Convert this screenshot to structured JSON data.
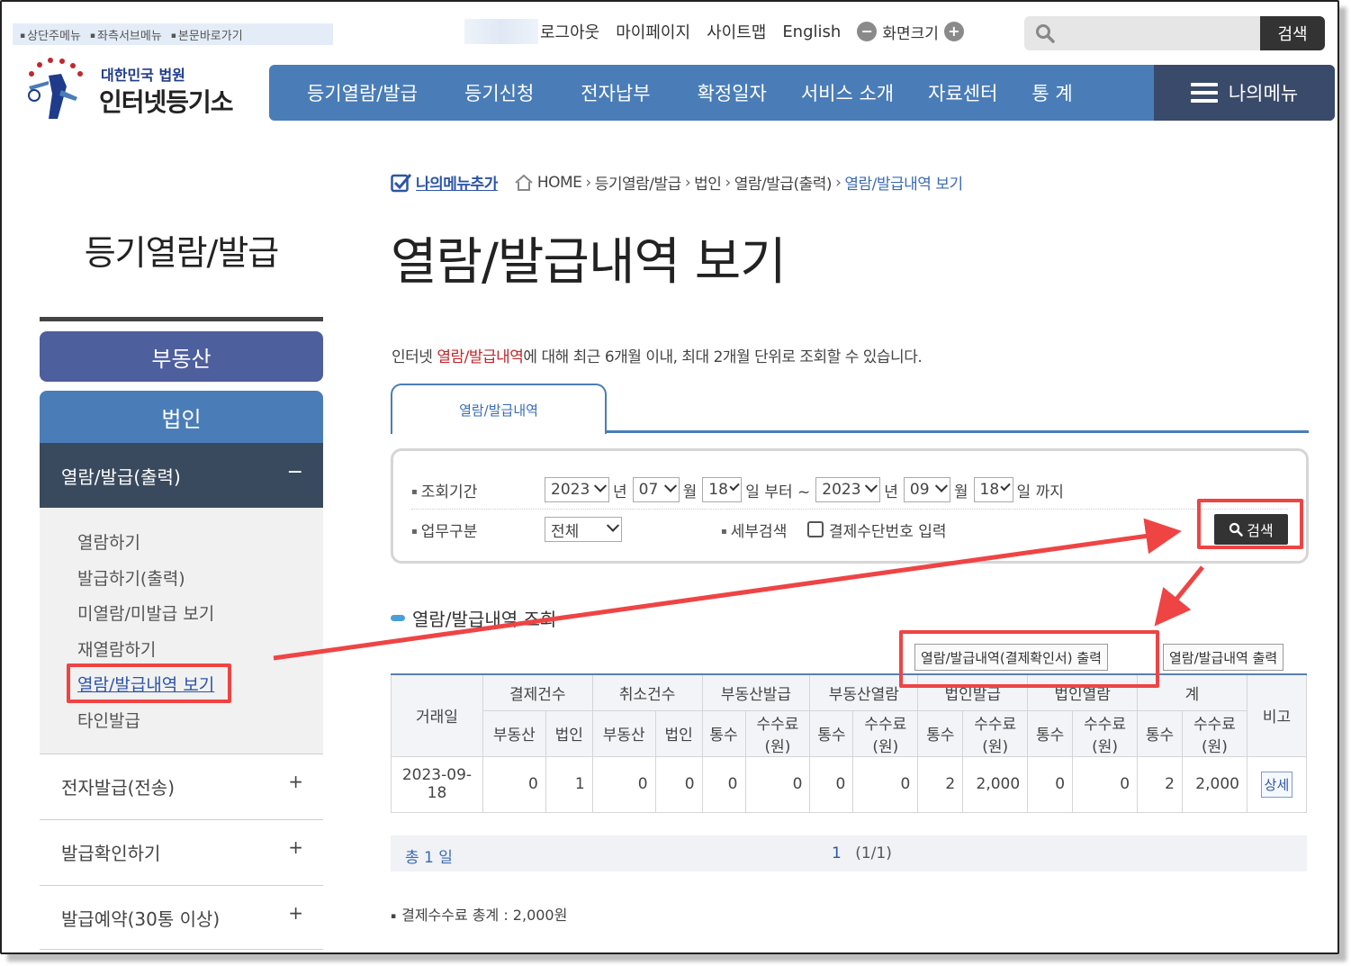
{
  "skip_links": [
    "상단주메뉴",
    "좌측서브메뉴",
    "본문바로가기"
  ],
  "util": {
    "logout": "로그아웃",
    "mypage": "마이페이지",
    "sitemap": "사이트맵",
    "english": "English",
    "zoom_label": "화면크기",
    "zoom_minus": "−",
    "zoom_plus": "+"
  },
  "search": {
    "placeholder": "",
    "button": "검색"
  },
  "logo": {
    "sub": "대한민국 법원",
    "main": "인터넷등기소"
  },
  "gnb": {
    "items": [
      "등기열람/발급",
      "등기신청",
      "전자납부",
      "확정일자",
      "서비스 소개",
      "자료센터",
      "통 계"
    ],
    "mymenu": "나의메뉴"
  },
  "sidebar": {
    "title": "등기열람/발급",
    "realty": "부동산",
    "corp": "법인",
    "open_section": "열람/발급(출력)",
    "sub_items": [
      "열람하기",
      "발급하기(출력)",
      "미열람/미발급 보기",
      "재열람하기",
      "열람/발급내역 보기",
      "타인발급"
    ],
    "rows": [
      "전자발급(전송)",
      "발급확인하기",
      "발급예약(30통 이상)"
    ]
  },
  "breadcrumb": {
    "add": "나의메뉴추가",
    "items": [
      "HOME",
      "등기열람/발급",
      "법인",
      "열람/발급(출력)",
      "열람/발급내역 보기"
    ]
  },
  "page_title": "열람/발급내역 보기",
  "desc": {
    "pre": "인터넷 ",
    "highlight": "열람/발급내역",
    "post": "에 대해 최근 6개월 이내, 최대 2개월 단위로 조회할 수 있습니다."
  },
  "tab": "열람/발급내역",
  "filter": {
    "period_label": "조회기간",
    "from_year": "2023",
    "from_month": "07",
    "from_day": "18",
    "to_year": "2023",
    "to_month": "09",
    "to_day": "18",
    "u_year": "년",
    "u_month": "월",
    "u_day_from": "일 부터 ~",
    "u_day_to": "일 까지",
    "type_label": "업무구분",
    "type_value": "전체",
    "detail_label": "세부검색",
    "checkbox_label": "결제수단번호 입력",
    "search_button": "검색"
  },
  "section_title": "열람/발급내역 조회",
  "buttons": {
    "print_receipt": "열람/발급내역(결제확인서) 출력",
    "print_list": "열람/발급내역 출력"
  },
  "table": {
    "h_date": "거래일",
    "h_groups": [
      "결제건수",
      "취소건수",
      "부동산발급",
      "부동산열람",
      "법인발급",
      "법인열람",
      "계"
    ],
    "h_note": "비고",
    "h_sub": [
      "부동산",
      "법인",
      "부동산",
      "법인",
      "통수",
      "수수료(원)",
      "통수",
      "수수료(원)",
      "통수",
      "수수료(원)",
      "통수",
      "수수료(원)",
      "통수",
      "수수료(원)"
    ],
    "rows": [
      {
        "date": "2023-09-18",
        "cells": [
          "0",
          "1",
          "0",
          "0",
          "0",
          "0",
          "0",
          "0",
          "2",
          "2,000",
          "0",
          "0",
          "2",
          "2,000"
        ],
        "note": "상세"
      }
    ]
  },
  "pager": {
    "total": "총 1 일",
    "page": "1",
    "range": "(1/1)"
  },
  "fee_total": "결제수수료 총계 : 2,000원",
  "colors": {
    "nav": "#4a7db8",
    "mymenu": "#3a4a6b",
    "highlight_box": "#ef4444",
    "accent_text": "#c0282d"
  }
}
